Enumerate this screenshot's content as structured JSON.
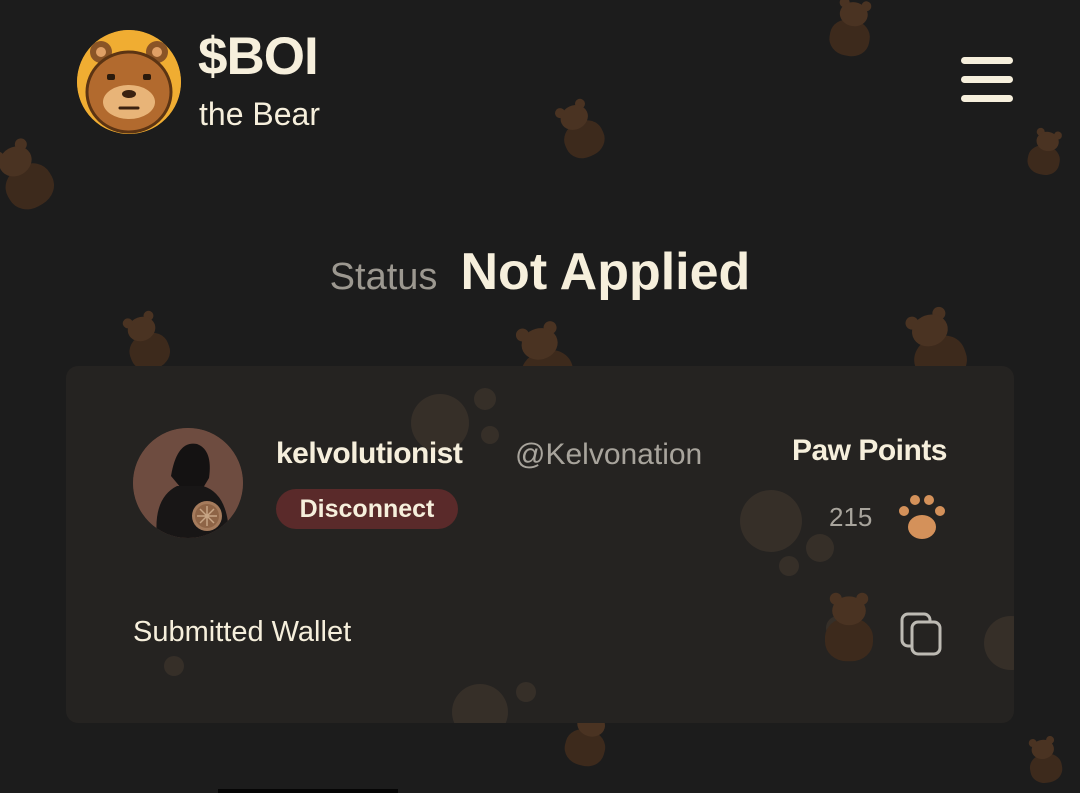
{
  "header": {
    "logo_icon": "bear-face-icon",
    "title": "$BOI",
    "subtitle": "the Bear",
    "menu_icon": "hamburger-menu-icon"
  },
  "status": {
    "label": "Status",
    "value": "Not Applied"
  },
  "profile": {
    "avatar": "user-avatar",
    "username": "kelvolutionist",
    "handle": "@Kelvonation",
    "disconnect_label": "Disconnect"
  },
  "points": {
    "title": "Paw Points",
    "value": "215",
    "icon": "paw-icon"
  },
  "wallet": {
    "label": "Submitted Wallet",
    "copy_icon": "copy-icon"
  },
  "colors": {
    "background": "#1c1c1c",
    "card": "#252321",
    "text": "#f6efdc",
    "muted": "#9c9890",
    "logo": "#f0ad32",
    "disconnect_bg": "#5a2a2a",
    "paw": "#d4915a"
  }
}
